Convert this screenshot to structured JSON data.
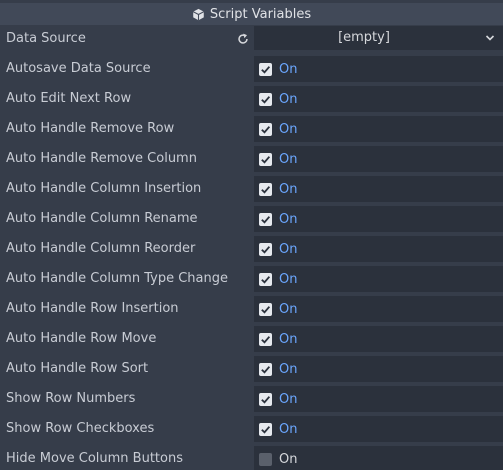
{
  "section": {
    "title": "Script Variables",
    "icon": "cube-icon"
  },
  "data_source": {
    "label": "Data Source",
    "value": "[empty]",
    "reset_icon": "reload-icon",
    "dropdown_icon": "chevron-down-icon"
  },
  "properties": [
    {
      "label": "Autosave Data Source",
      "value": "On",
      "checked": true
    },
    {
      "label": "Auto Edit Next Row",
      "value": "On",
      "checked": true
    },
    {
      "label": "Auto Handle Remove Row",
      "value": "On",
      "checked": true
    },
    {
      "label": "Auto Handle Remove Column",
      "value": "On",
      "checked": true
    },
    {
      "label": "Auto Handle Column Insertion",
      "value": "On",
      "checked": true
    },
    {
      "label": "Auto Handle Column Rename",
      "value": "On",
      "checked": true
    },
    {
      "label": "Auto Handle Column Reorder",
      "value": "On",
      "checked": true
    },
    {
      "label": "Auto Handle Column Type Change",
      "value": "On",
      "checked": true
    },
    {
      "label": "Auto Handle Row Insertion",
      "value": "On",
      "checked": true
    },
    {
      "label": "Auto Handle Row Move",
      "value": "On",
      "checked": true
    },
    {
      "label": "Auto Handle Row Sort",
      "value": "On",
      "checked": true
    },
    {
      "label": "Show Row Numbers",
      "value": "On",
      "checked": true
    },
    {
      "label": "Show Row Checkboxes",
      "value": "On",
      "checked": true
    },
    {
      "label": "Hide Move Column Buttons",
      "value": "On",
      "checked": false
    }
  ],
  "colors": {
    "panel_bg": "#363d4a",
    "header_bg": "#414958",
    "field_bg": "#2b313c",
    "checked_text": "#6ba7ff",
    "unchecked_text": "#d6d8dc"
  }
}
